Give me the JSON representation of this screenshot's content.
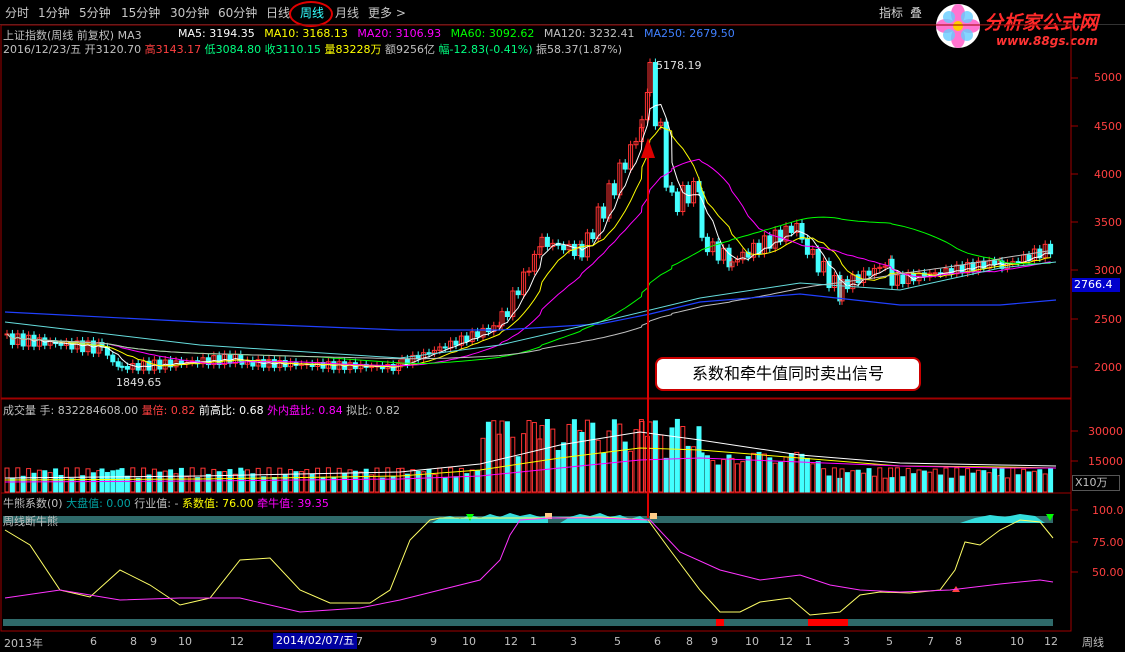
{
  "toolbar": {
    "tabs": [
      "分时",
      "1分钟",
      "5分钟",
      "15分钟",
      "30分钟",
      "60分钟",
      "日线",
      "周线",
      "月线",
      "更多 >"
    ],
    "active_tab": "周线",
    "right_buttons": [
      "指标",
      "叠"
    ]
  },
  "logo": {
    "title": "分析家公式网",
    "url": "www.88gs.com"
  },
  "header": {
    "index_name": "上证指数(周线 前复权) MA3",
    "ma": [
      {
        "label": "MA5: 3194.35",
        "color": "#ffffff"
      },
      {
        "label": "MA10: 3168.13",
        "color": "#ffff00"
      },
      {
        "label": "MA20: 3106.93",
        "color": "#ff00ff"
      },
      {
        "label": "MA60: 3092.62",
        "color": "#00ff00"
      },
      {
        "label": "MA120: 3232.41",
        "color": "#c0c0c0"
      },
      {
        "label": "MA250: 2679.50",
        "color": "#4080ff"
      }
    ],
    "ohlc_line": [
      {
        "text": "2016/12/23/五 ",
        "color": "#c0c0c0"
      },
      {
        "text": "开3120.70 ",
        "color": "#c0c0c0"
      },
      {
        "text": "高3143.17 ",
        "color": "#ff4040"
      },
      {
        "text": "低3084.80 ",
        "color": "#00ff80"
      },
      {
        "text": "收3110.15 ",
        "color": "#00ff80"
      },
      {
        "text": "量83228万 ",
        "color": "#ffff00"
      },
      {
        "text": "额9256亿 ",
        "color": "#c0c0c0"
      },
      {
        "text": "幅-12.83(-0.41%) ",
        "color": "#00ff80"
      },
      {
        "text": "振58.37(1.87%)",
        "color": "#c0c0c0"
      }
    ]
  },
  "price_panel": {
    "y_labels": [
      "5000",
      "4500",
      "4000",
      "3500",
      "3000",
      "2500",
      "2000"
    ],
    "high_label": "5178.19",
    "low_label": "1849.65",
    "current_price": "2766.4",
    "callout": "系数和牵牛值同时卖出信号"
  },
  "volume_panel": {
    "header": [
      {
        "text": "成交量  手: 832284608.00 ",
        "color": "#c0c0c0"
      },
      {
        "text": "量倍: 0.82 ",
        "color": "#ff4040"
      },
      {
        "text": "前高比: 0.68 ",
        "color": "#ffffff"
      },
      {
        "text": "外内盘比: 0.84 ",
        "color": "#ff00ff"
      },
      {
        "text": "拟比: 0.82",
        "color": "#c0c0c0"
      }
    ],
    "y_labels": [
      "30000",
      "15000"
    ],
    "unit": "X10万"
  },
  "indicator_panel": {
    "header": [
      {
        "text": "牛熊系数(0)  ",
        "color": "#c0c0c0"
      },
      {
        "text": "大盘值: 0.00 ",
        "color": "#00a0a0"
      },
      {
        "text": "行业值: - ",
        "color": "#c0c0c0"
      },
      {
        "text": "系数值: 76.00 ",
        "color": "#ffff00"
      },
      {
        "text": "牵牛值: 39.35",
        "color": "#ff00ff"
      }
    ],
    "subtitle": "周线断牛熊",
    "y_labels": [
      "100.0",
      "75.00",
      "50.00"
    ]
  },
  "x_axis": {
    "labels": [
      "2013年",
      "6",
      "8",
      "9",
      "10",
      "12",
      "7",
      "9",
      "10",
      "12",
      "1",
      "3",
      "5",
      "6",
      "8",
      "9",
      "10",
      "12",
      "1",
      "3",
      "5",
      "7",
      "8",
      "10",
      "12"
    ],
    "highlight_date": "2014/02/07/五",
    "period": "周线"
  }
}
